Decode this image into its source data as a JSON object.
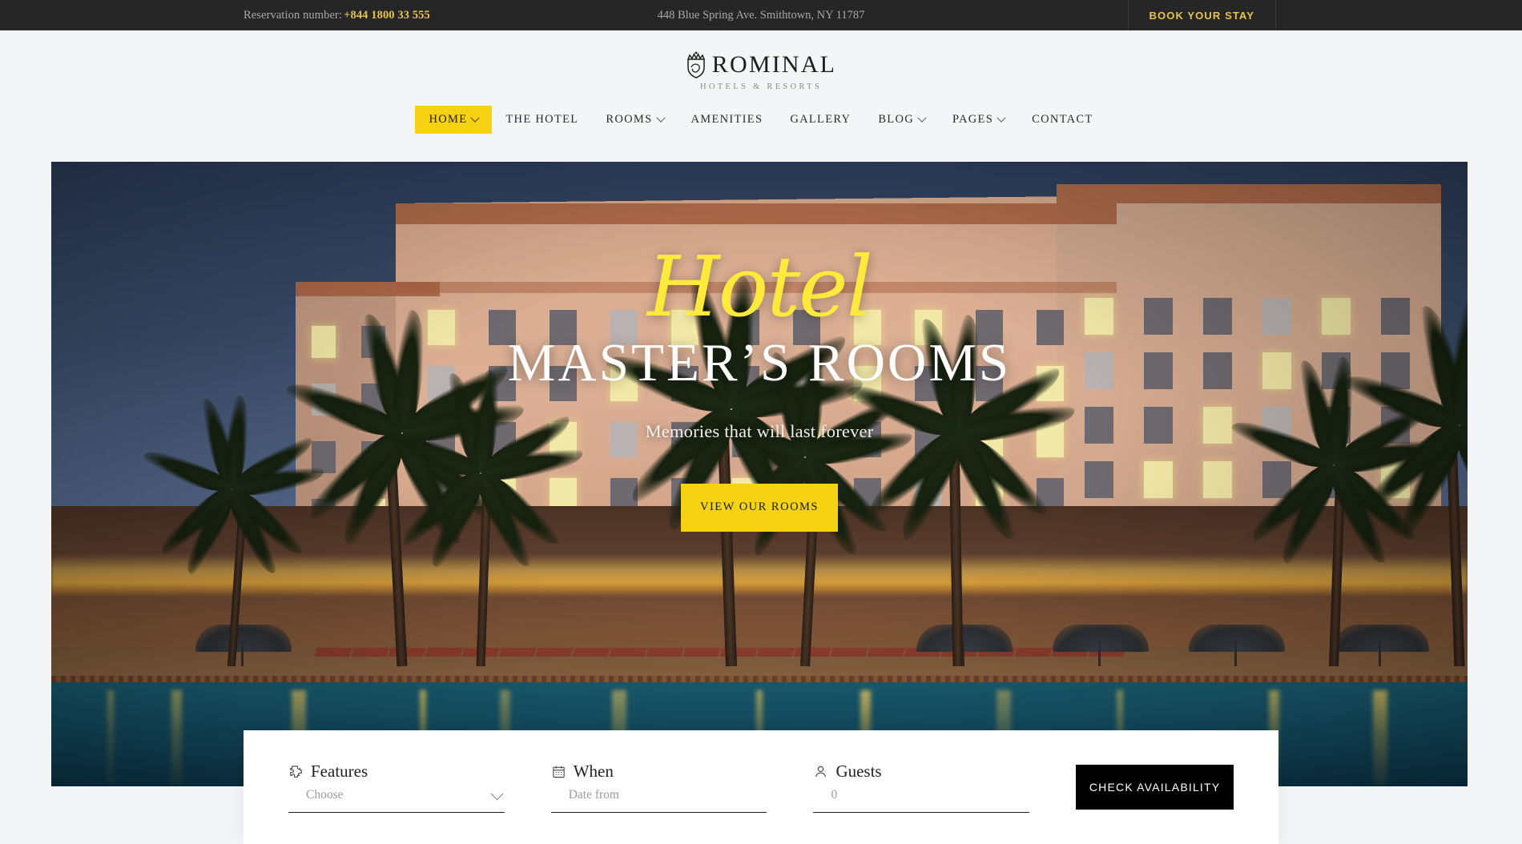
{
  "topbar": {
    "reservation_label": "Reservation number:",
    "phone": "+844 1800 33 555",
    "address": "448 Blue Spring Ave. Smithtown, NY 11787",
    "cta": "BOOK YOUR STAY",
    "bg_color": "#262626",
    "accent_color": "#e8c547"
  },
  "brand": {
    "name": "ROMINAL",
    "tagline": "HOTELS & RESORTS",
    "crest_icon": "crown-shield-icon"
  },
  "nav": {
    "items": [
      {
        "label": "HOME",
        "has_dropdown": true,
        "active": true
      },
      {
        "label": "THE HOTEL",
        "has_dropdown": false,
        "active": false
      },
      {
        "label": "ROOMS",
        "has_dropdown": true,
        "active": false
      },
      {
        "label": "AMENITIES",
        "has_dropdown": false,
        "active": false
      },
      {
        "label": "GALLERY",
        "has_dropdown": false,
        "active": false
      },
      {
        "label": "BLOG",
        "has_dropdown": true,
        "active": false
      },
      {
        "label": "PAGES",
        "has_dropdown": true,
        "active": false
      },
      {
        "label": "CONTACT",
        "has_dropdown": false,
        "active": false
      }
    ],
    "active_bg": "#f5d312"
  },
  "hero": {
    "script_text": "Hotel",
    "headline": "MASTER’S ROOMS",
    "subtitle": "Memories that will last forever",
    "button_label": "VIEW OUR ROOMS",
    "accent_color": "#f5d312",
    "script_color": "#ffe93a",
    "scene": "hotel-resort-at-dusk-with-pool-and-palm-trees"
  },
  "booking": {
    "features": {
      "label": "Features",
      "placeholder": "Choose",
      "value": "",
      "icon": "puzzle-piece-icon"
    },
    "when": {
      "label": "When",
      "placeholder": "Date from",
      "value": "",
      "icon": "calendar-icon"
    },
    "guests": {
      "label": "Guests",
      "placeholder": "0",
      "value": "0",
      "icon": "user-icon"
    },
    "submit_label": "CHECK AVAILABILITY",
    "submit_bg": "#000000"
  }
}
